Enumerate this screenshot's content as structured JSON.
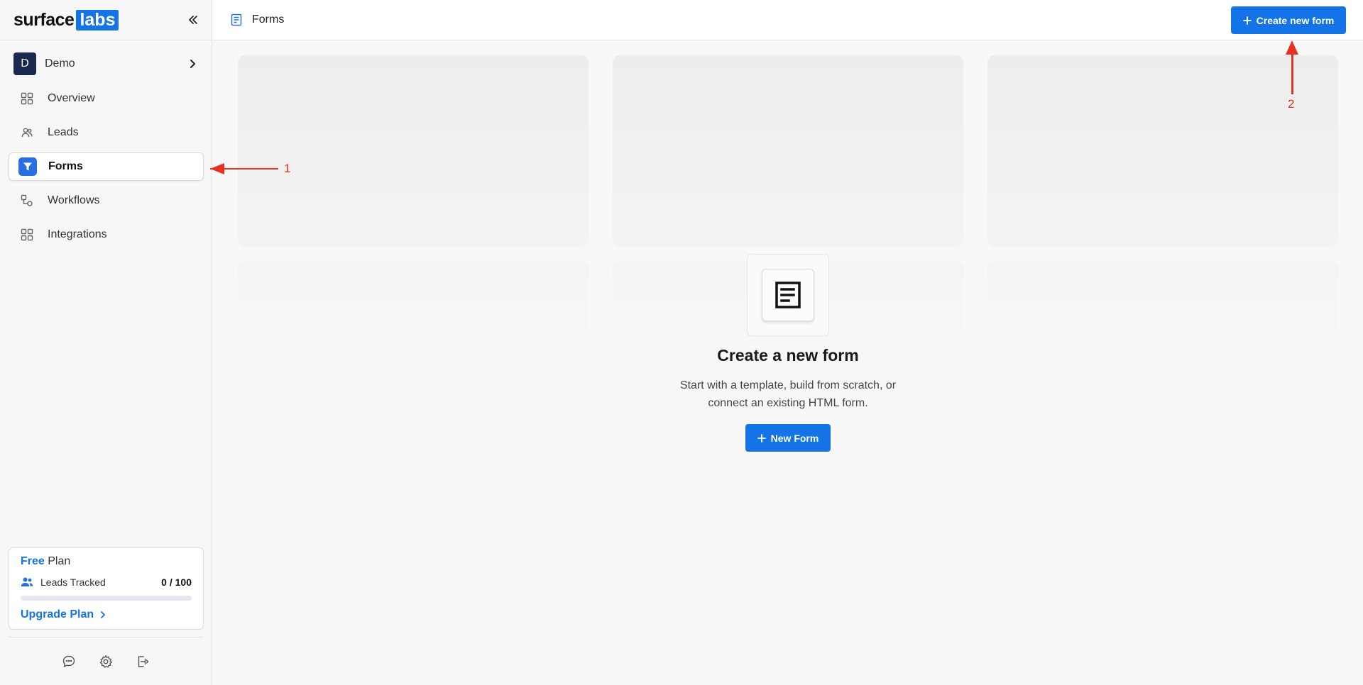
{
  "brand": {
    "name_part1": "surface",
    "name_part2": "labs"
  },
  "workspace": {
    "initial": "D",
    "name": "Demo"
  },
  "nav": {
    "items": [
      {
        "label": "Overview",
        "icon": "grid-icon"
      },
      {
        "label": "Leads",
        "icon": "users-icon"
      },
      {
        "label": "Forms",
        "icon": "filter-icon",
        "active": true
      },
      {
        "label": "Workflows",
        "icon": "workflow-icon"
      },
      {
        "label": "Integrations",
        "icon": "grid-icon"
      }
    ]
  },
  "plan": {
    "tier": "Free",
    "label": "Plan",
    "metric_label": "Leads Tracked",
    "usage": "0 / 100",
    "usage_fraction": 0,
    "upgrade_label": "Upgrade Plan"
  },
  "header": {
    "title": "Forms",
    "create_button": "Create new form"
  },
  "empty_state": {
    "title": "Create a new form",
    "description_line1": "Start with a template, build from scratch, or",
    "description_line2": "connect an existing HTML form.",
    "button": "New Form"
  },
  "annotations": {
    "one": "1",
    "two": "2"
  },
  "colors": {
    "accent": "#1473e6",
    "annotation": "#e8301f",
    "avatar": "#1a2a4f"
  }
}
